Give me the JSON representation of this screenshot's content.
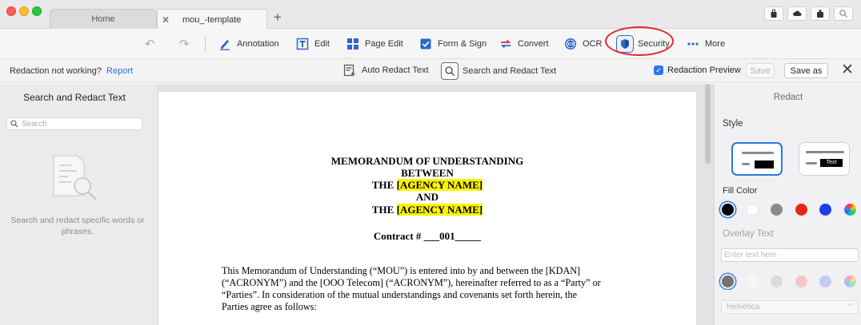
{
  "tabs": [
    {
      "label": "Home"
    },
    {
      "label": "mou_-template",
      "close": "✕"
    }
  ],
  "new_tab_symbol": "+",
  "toolbar": {
    "undo": "↶",
    "redo": "↷",
    "annotation": "Annotation",
    "edit": "Edit",
    "page_edit": "Page Edit",
    "form_sign": "Form & Sign",
    "convert": "Convert",
    "ocr": "OCR",
    "security": "Security",
    "more": "More"
  },
  "redaction_bar": {
    "notice": "Redaction not working?",
    "report_link": "Report",
    "auto_redact": "Auto Redact Text",
    "search_redact": "Search and Redact Text",
    "preview_label": "Redaction Preview",
    "preview_checked": true,
    "save": "Save",
    "save_as": "Save as",
    "close": "✕"
  },
  "left_panel": {
    "title": "Search and Redact Text",
    "search_placeholder": "Search",
    "hint": "Search and redact specific words or phrases."
  },
  "document": {
    "heading_line1": "MEMORANDUM OF UNDERSTANDING",
    "heading_line2": "BETWEEN",
    "the_prefix": "THE",
    "agency_placeholder": "[AGENCY NAME]",
    "heading_and": "AND",
    "contract_line": "Contract # ___001_____",
    "body_lines": [
      "This Memorandum of Understanding (“MOU”) is entered into by and between the [KDAN]",
      "(“ACRONYM”) and the [OOO Telecom] (“ACRONYM”), hereinafter referred to as a “Party” or",
      "“Parties”. In consideration of the mutual understandings and covenants set forth herein, the",
      "Parties agree as follows:"
    ]
  },
  "right_panel": {
    "title": "Redact",
    "style_label": "Style",
    "style_text_sample": "Text",
    "fill_color_label": "Fill Color",
    "fill_colors": [
      "#000000",
      "#ffffff",
      "#8a8a8a",
      "#e8261a",
      "#1d3ee8",
      "rainbow"
    ],
    "overlay_text_label": "Overlay Text",
    "overlay_placeholder": "Enter text here",
    "overlay_colors": [
      "#666666",
      "#ffffff",
      "#bcbcbc",
      "#f48a7c",
      "#7d96f0",
      "rainbow"
    ],
    "font": "Helvetica"
  },
  "colors": {
    "accent": "#2c76e6",
    "highlight": "#fbf400",
    "annotation_circle": "#e8262a"
  }
}
